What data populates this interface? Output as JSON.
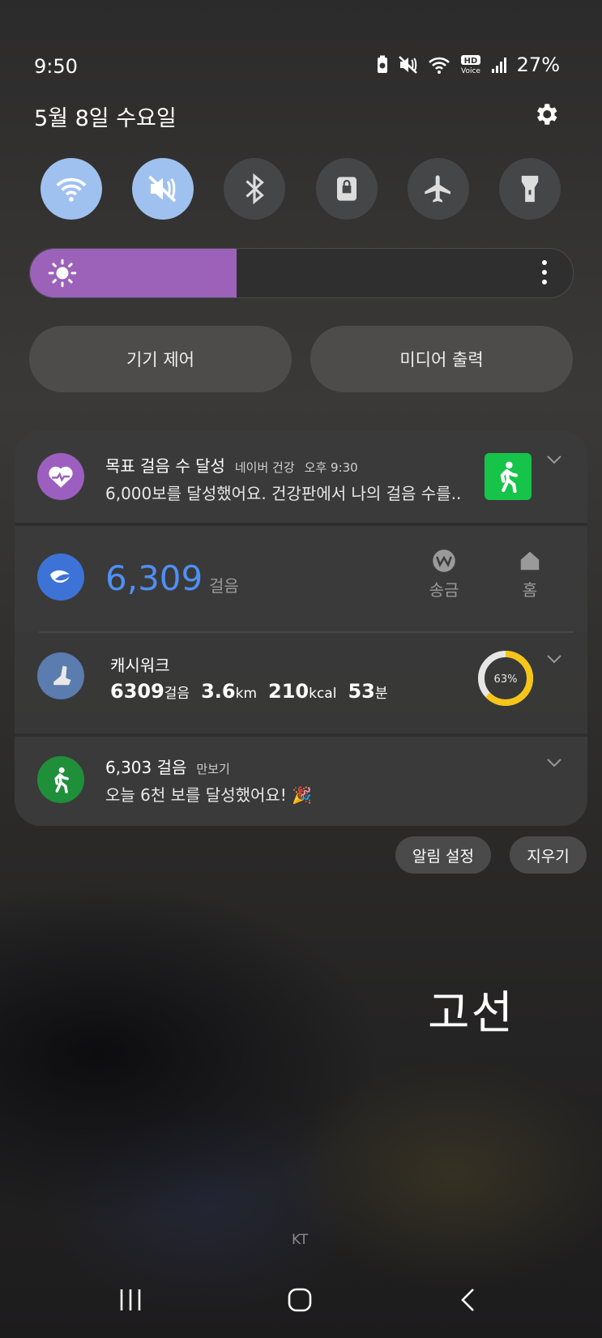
{
  "status_bar": {
    "time": "9:50",
    "battery": "27%",
    "icons": [
      "battery-saver-icon",
      "mute-icon",
      "wifi-icon",
      "hd-voice-icon",
      "signal-icon"
    ],
    "hd_top": "HD",
    "hd_bottom": "Voice"
  },
  "header": {
    "date": "5월 8일 수요일"
  },
  "quick_settings": [
    {
      "name": "wifi",
      "active": true
    },
    {
      "name": "mute",
      "active": true
    },
    {
      "name": "bluetooth",
      "active": false
    },
    {
      "name": "rotation-lock",
      "active": false
    },
    {
      "name": "airplane-mode",
      "active": false
    },
    {
      "name": "flashlight",
      "active": false
    }
  ],
  "brightness": {
    "level_percent": 38
  },
  "buttons": {
    "device_control": "기기 제어",
    "media_output": "미디어 출력"
  },
  "notifications": {
    "naver": {
      "title": "목표 걸음 수 달성",
      "app": "네이버 건강",
      "time": "오후 9:30",
      "body": "6,000보를 달성했어요. 건강판에서 나의 걸음 수를.."
    },
    "toss": {
      "steps": "6,309",
      "unit": "걸음",
      "action1": "송금",
      "action2": "홈"
    },
    "cashwalk": {
      "title": "캐시워크",
      "steps": "6309",
      "steps_unit": "걸음",
      "distance": "3.6",
      "distance_unit": "km",
      "calories": "210",
      "calories_unit": "kcal",
      "minutes": "53",
      "minutes_unit": "분",
      "progress_label": "63%",
      "progress": 0.63
    },
    "pedometer": {
      "title": "6,303 걸음",
      "app": "만보기",
      "body": "오늘 6천 보를 달성했어요! 🎉"
    }
  },
  "footer_buttons": {
    "notification_settings": "알림 설정",
    "clear": "지우기"
  },
  "wallpaper_text": "고선",
  "carrier": "KT",
  "colors": {
    "accent_blue": "#4f8ff5",
    "brightness": "#9c62b9",
    "progress": "#f5c518",
    "naver_purple": "#9c5fc0",
    "pedometer_green": "#1f8f3a"
  }
}
